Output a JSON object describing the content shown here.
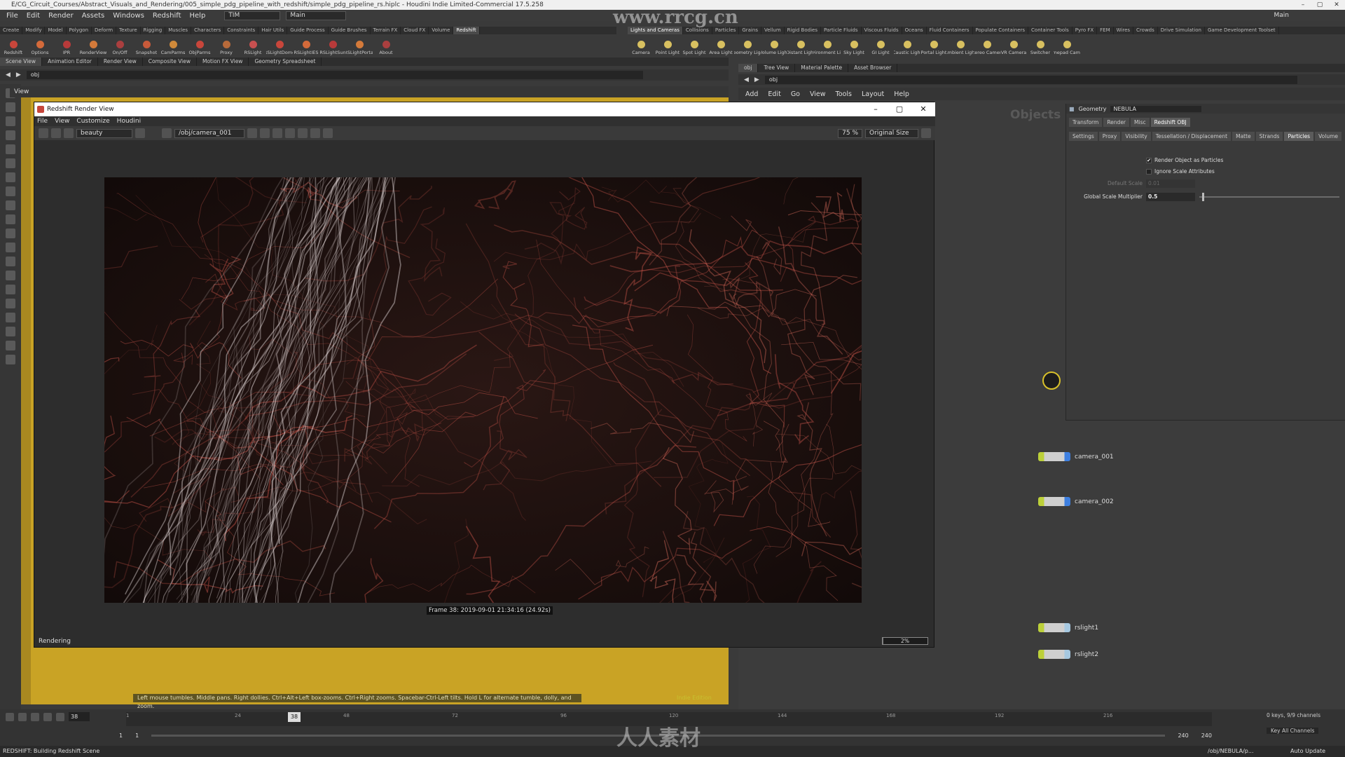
{
  "window": {
    "title": "E/CG_Circuit_Courses/Abstract_Visuals_and_Rendering/005_simple_pdg_pipeline_with_redshift/simple_pdg_pipeline_rs.hiplc - Houdini Indie Limited-Commercial 17.5.258"
  },
  "menubar": {
    "items": [
      "File",
      "Edit",
      "Render",
      "Assets",
      "Windows",
      "Redshift",
      "Help"
    ],
    "desktop": "TIM",
    "main": "Main",
    "right_main": "Main"
  },
  "shelf_left": {
    "tabs": [
      "Create",
      "Modify",
      "Model",
      "Polygon",
      "Deform",
      "Texture",
      "Rigging",
      "Muscles",
      "Characters",
      "Constraints",
      "Hair Utils",
      "Guide Process",
      "Guide Brushes",
      "Terrain FX",
      "Cloud FX",
      "Volume",
      "Redshift"
    ],
    "active": "Redshift",
    "tools": [
      "Redshift",
      "Options",
      "IPR",
      "RenderView",
      "On/Off",
      "Snapshot",
      "CamParms",
      "ObjParms",
      "Proxy",
      "RSLight",
      "RSLightDome",
      "RSLightIES",
      "RSLightSun",
      "RSLightPortal",
      "About"
    ]
  },
  "shelf_right": {
    "tabs": [
      "Lights and Cameras",
      "Collisions",
      "Particles",
      "Grains",
      "Vellum",
      "Rigid Bodies",
      "Particle Fluids",
      "Viscous Fluids",
      "Oceans",
      "Fluid Containers",
      "Populate Containers",
      "Container Tools",
      "Pyro FX",
      "FEM",
      "Wires",
      "Crowds",
      "Drive Simulation",
      "Game Development Toolset"
    ],
    "active": "Lights and Cameras",
    "tools": [
      "Camera",
      "Point Light",
      "Spot Light",
      "Area Light",
      "Geometry Light",
      "Volume Light",
      "Distant Light",
      "Environment Light",
      "Sky Light",
      "GI Light",
      "Caustic Light",
      "Portal Light",
      "Ambient Light",
      "Stereo Camera",
      "VR Camera",
      "Switcher",
      "Gamepad Camera"
    ]
  },
  "left_pane": {
    "tabs": [
      "Scene View",
      "Animation Editor",
      "Render View",
      "Composite View",
      "Motion FX View",
      "Geometry Spreadsheet"
    ],
    "path": "obj",
    "view_label": "View",
    "hint": "Left mouse tumbles. Middle pans. Right dollies. Ctrl+Alt+Left box-zooms. Ctrl+Right zooms. Spacebar-Ctrl-Left tilts. Hold L for alternate tumble, dolly, and zoom.",
    "edition": "Indie Edition"
  },
  "right_pane": {
    "tabs": [
      "obj",
      "Tree View",
      "Material Palette",
      "Asset Browser"
    ],
    "path": "obj",
    "menu": [
      "Add",
      "Edit",
      "Go",
      "View",
      "Tools",
      "Layout",
      "Help"
    ],
    "context_label": "Objects"
  },
  "render_view": {
    "title": "Redshift Render View",
    "menu": [
      "File",
      "View",
      "Customize",
      "Houdini"
    ],
    "aov": "beauty",
    "camera": "/obj/camera_001",
    "zoom": "75 %",
    "size_mode": "Original Size",
    "frame_info": "Frame  38:  2019-09-01  21:34:16  (24.92s)",
    "status": "Rendering",
    "progress_label": "2%",
    "progress": 0.02
  },
  "parameters": {
    "type": "Geometry",
    "name": "NEBULA",
    "tabs_top": [
      "Transform",
      "Render",
      "Misc",
      "Redshift OBJ"
    ],
    "active_top": "Redshift OBJ",
    "tabs_sub": [
      "Settings",
      "Proxy",
      "Visibility",
      "Tessellation / Displacement",
      "Matte",
      "Strands",
      "Particles",
      "Volume"
    ],
    "active_sub": "Particles",
    "render_as_particles_label": "Render Object as Particles",
    "render_as_particles": true,
    "ignore_scale_label": "Ignore Scale Attributes",
    "ignore_scale": false,
    "default_scale_label": "Default Scale",
    "default_scale": "0.01",
    "global_scale_label": "Global Scale Multiplier",
    "global_scale": "0.5",
    "global_scale_fraction": 0.02
  },
  "nodes": [
    {
      "label": "camera_001",
      "color": "#3d7fe0"
    },
    {
      "label": "camera_002",
      "color": "#3d7fe0"
    },
    {
      "label": "rslight1",
      "color": "#a6c8e0"
    },
    {
      "label": "rslight2",
      "color": "#a6c8e0"
    }
  ],
  "timeline": {
    "current_frame": "38",
    "ticks": [
      "1",
      "24",
      "48",
      "72",
      "96",
      "120",
      "144",
      "168",
      "192",
      "216"
    ],
    "range_start": "1",
    "range_start2": "1",
    "range_end": "240",
    "range_end2": "240",
    "keys": "0 keys, 9/9 channels",
    "key_channels": "Key All Channels"
  },
  "status": {
    "message": "REDSHIFT: Building Redshift Scene",
    "node_path": "/obj/NEBULA/p...",
    "auto_update": "Auto Update"
  },
  "watermarks": {
    "top": "www.rrcg.cn",
    "bottom": "人人素材"
  },
  "colors": {
    "viewport": "#c9a325",
    "render_bg": "#150d0c",
    "filament_red": "#c9554a",
    "filament_white": "#e6dcdc"
  }
}
